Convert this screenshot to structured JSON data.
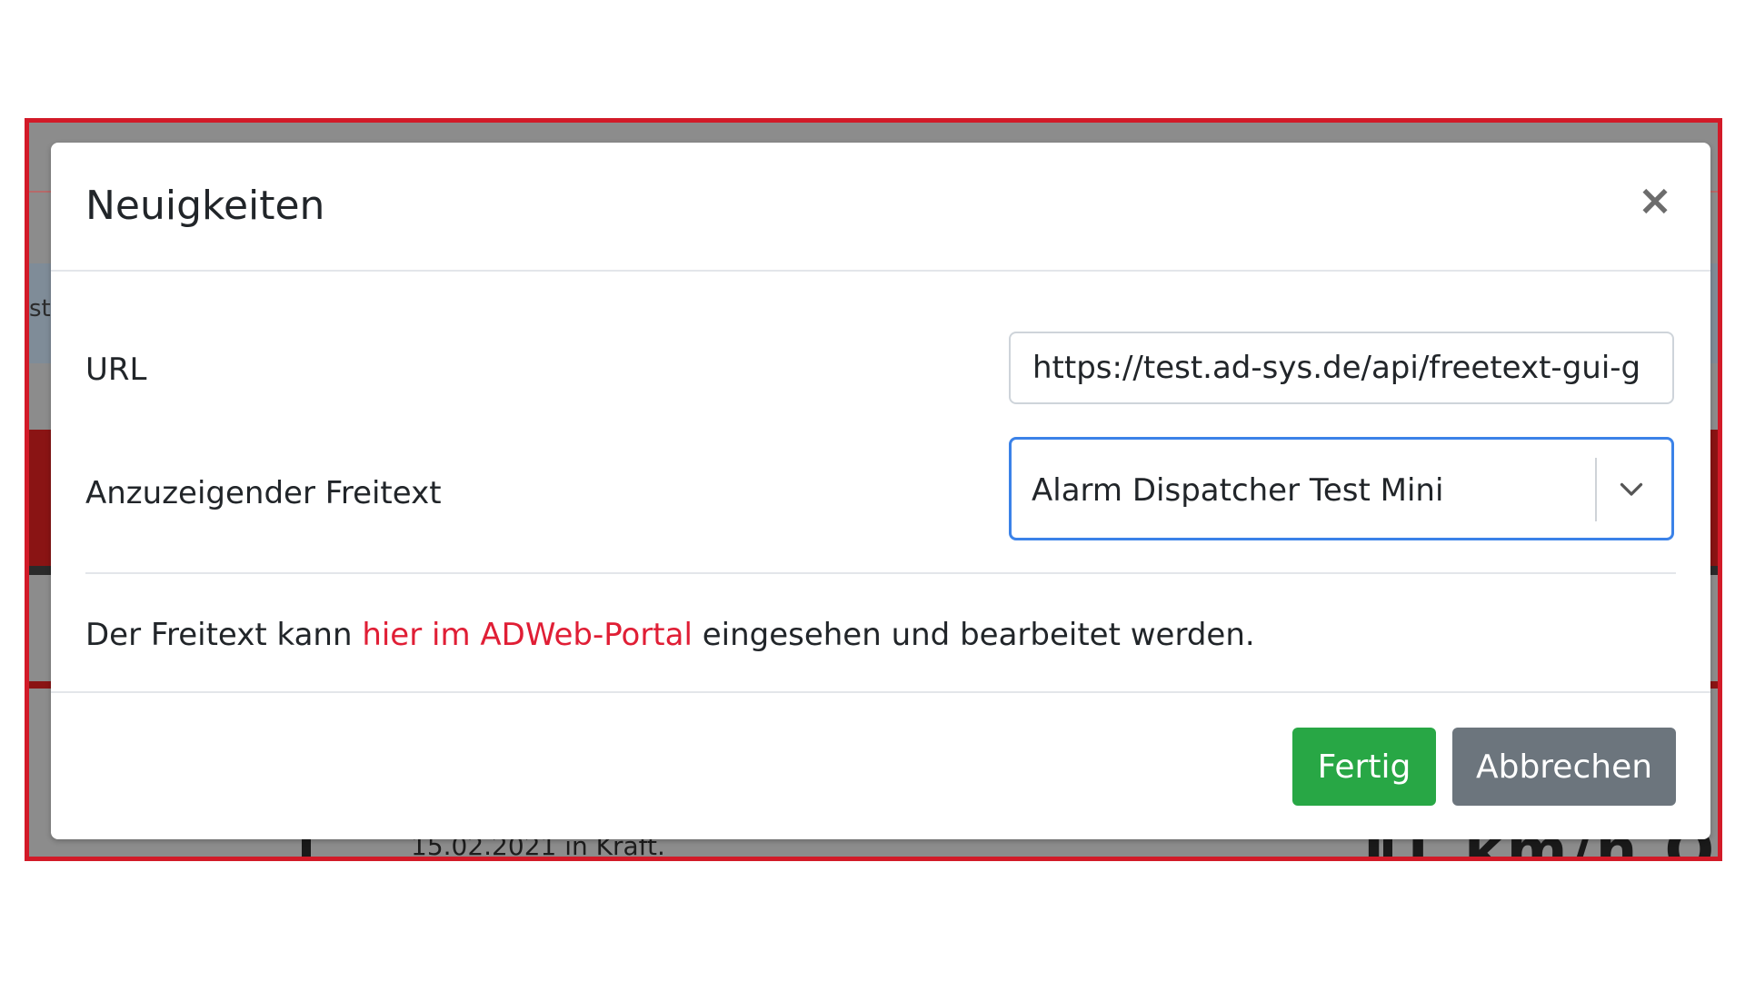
{
  "modal": {
    "title": "Neuigkeiten",
    "close_symbol": "×",
    "fields": {
      "url": {
        "label": "URL",
        "value": "https://test.ad-sys.de/api/freetext-gui-g"
      },
      "freetext": {
        "label": "Anzuzeigender Freitext",
        "selected": "Alarm Dispatcher Test Mini"
      }
    },
    "info": {
      "prefix": "Der Freitext kann ",
      "link": "hier im ADWeb-Portal",
      "suffix": " eingesehen und bearbeitet werden."
    },
    "buttons": {
      "done": "Fertig",
      "cancel": "Abbrechen"
    }
  },
  "background": {
    "peek_left": "st",
    "bottom_text": "15.02.2021 in Kraft.",
    "speed_text": "11 km/h O"
  },
  "colors": {
    "frame_border": "#d21a28",
    "link": "#e01e35",
    "select_focus": "#3b82e8",
    "done_button": "#28a745",
    "cancel_button": "#6c757d"
  },
  "icons": {
    "close": "close-icon",
    "dropdown": "chevron-down-icon"
  }
}
